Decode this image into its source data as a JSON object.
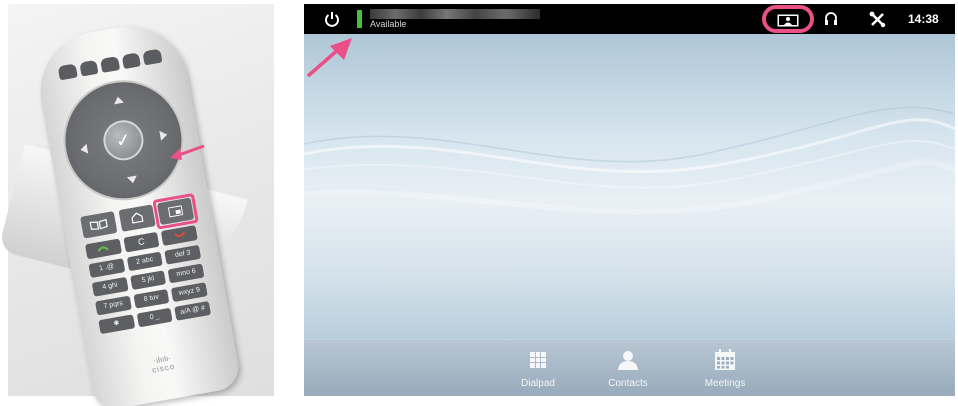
{
  "remote": {
    "ok_label": "✓",
    "clear_label": "C",
    "keys": [
      "1 .@",
      "2 abc",
      "def 3",
      "4 ghi",
      "5 jkl",
      "mno 6",
      "7 pqrs",
      "8 tuv",
      "wxyz 9",
      "✱",
      "0 _",
      "a/A @ #"
    ],
    "brand": "cisco",
    "brand_bars": "·ılıılı·"
  },
  "status_bar": {
    "status": "Available",
    "time": "14:38"
  },
  "bottom_bar": {
    "items": [
      {
        "label": "Dialpad",
        "icon": "dialpad-icon"
      },
      {
        "label": "Contacts",
        "icon": "contacts-icon"
      },
      {
        "label": "Meetings",
        "icon": "calendar-icon"
      }
    ]
  },
  "colors": {
    "highlight": "#ea4f87",
    "presence": "#49c13a",
    "status_bar_bg": "#000000"
  }
}
